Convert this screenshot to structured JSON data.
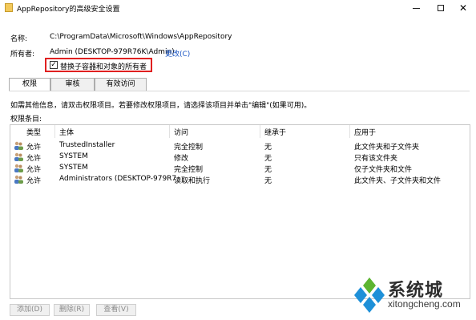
{
  "window": {
    "title": "AppRepository的高级安全设置"
  },
  "name_row": {
    "label": "名称:",
    "value": "C:\\ProgramData\\Microsoft\\Windows\\AppRepository"
  },
  "owner_row": {
    "label": "所有者:",
    "value": "Admin (DESKTOP-979R76K\\Admin)",
    "change_link": "更改(C)"
  },
  "replace_owner": {
    "label": "替换子容器和对象的所有者",
    "checked": true
  },
  "tabs": [
    {
      "label": "权限",
      "active": true
    },
    {
      "label": "审核",
      "active": false
    },
    {
      "label": "有效访问",
      "active": false
    }
  ],
  "info_text": "如需其他信息，请双击权限项目。若要修改权限项目，请选择该项目并单击\"编辑\"(如果可用)。",
  "entries_label": "权限条目:",
  "table": {
    "headers": [
      "类型",
      "主体",
      "访问",
      "继承于",
      "应用于"
    ],
    "rows": [
      {
        "type": "允许",
        "principal": "TrustedInstaller",
        "access": "完全控制",
        "inherited": "无",
        "applies": "此文件夹和子文件夹"
      },
      {
        "type": "允许",
        "principal": "SYSTEM",
        "access": "修改",
        "inherited": "无",
        "applies": "只有该文件夹"
      },
      {
        "type": "允许",
        "principal": "SYSTEM",
        "access": "完全控制",
        "inherited": "无",
        "applies": "仅子文件夹和文件"
      },
      {
        "type": "允许",
        "principal": "Administrators (DESKTOP-979R7...",
        "access": "读取和执行",
        "inherited": "无",
        "applies": "此文件夹、子文件夹和文件"
      }
    ]
  },
  "buttons": {
    "add": "添加(D)",
    "remove": "删除(R)",
    "view": "查看(V)"
  },
  "watermark": {
    "cn": "系统城",
    "en": "xitongcheng.com"
  },
  "colors": {
    "highlight_border": "#e02020",
    "link": "#1a55c4",
    "logo_blue": "#1e90d8",
    "logo_green": "#5cb531"
  }
}
